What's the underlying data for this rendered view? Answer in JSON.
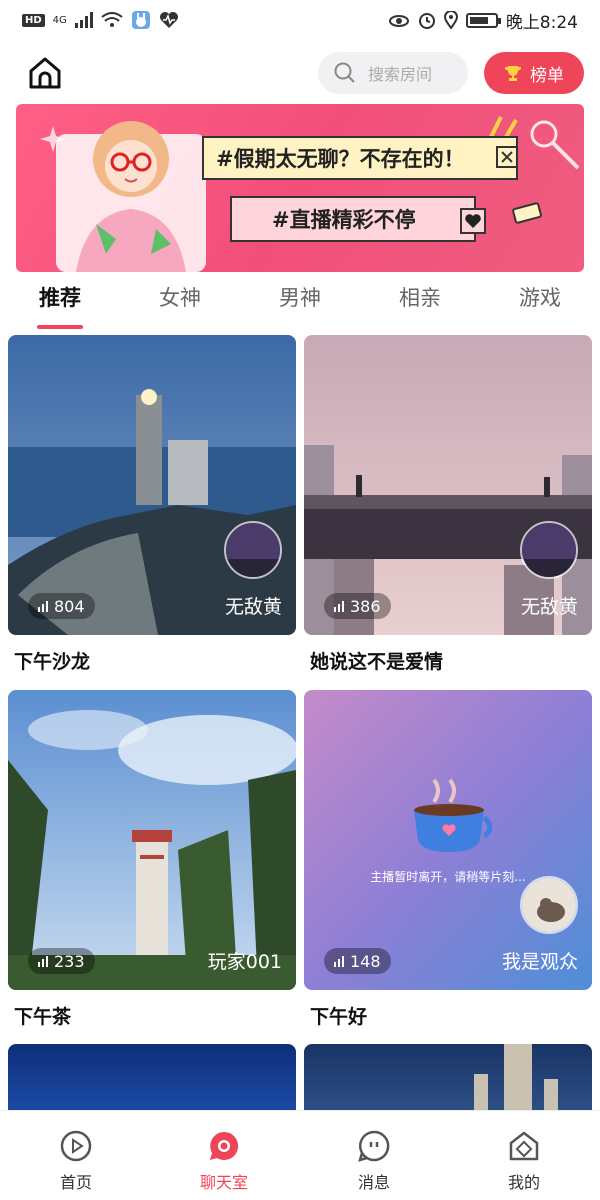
{
  "status_bar": {
    "hd": "HD",
    "network": "4G",
    "time": "晚上8:24"
  },
  "header": {
    "search_placeholder": "搜索房间",
    "rank_label": "榜单"
  },
  "banner": {
    "line1": "#假期太无聊？不存在的！",
    "line2": "#直播精彩不停"
  },
  "tabs": [
    {
      "label": "推荐",
      "active": true
    },
    {
      "label": "女神",
      "active": false
    },
    {
      "label": "男神",
      "active": false
    },
    {
      "label": "相亲",
      "active": false
    },
    {
      "label": "游戏",
      "active": false
    }
  ],
  "rooms": [
    {
      "title": "下午沙龙",
      "count": "804",
      "host": "无敌黄"
    },
    {
      "title": "她说这不是爱情",
      "count": "386",
      "host": "无敌黄"
    },
    {
      "title": "下午茶",
      "count": "233",
      "host": "玩家001"
    },
    {
      "title": "下午好",
      "count": "148",
      "host": "我是观众",
      "away_text": "主播暂时离开，请稍等片刻..."
    }
  ],
  "bottom_nav": [
    {
      "label": "首页",
      "icon": "play-circle-icon",
      "active": false
    },
    {
      "label": "聊天室",
      "icon": "chat-room-icon",
      "active": true
    },
    {
      "label": "消息",
      "icon": "message-icon",
      "active": false
    },
    {
      "label": "我的",
      "icon": "profile-icon",
      "active": false
    }
  ],
  "colors": {
    "accent": "#ef4558"
  }
}
